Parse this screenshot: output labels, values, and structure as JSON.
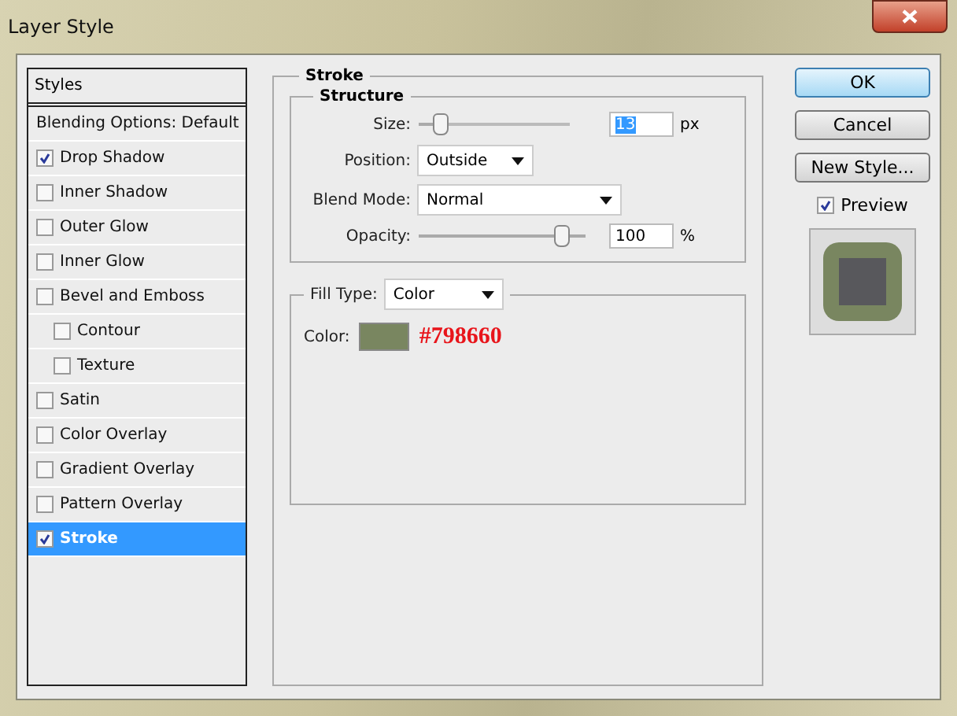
{
  "window": {
    "title": "Layer Style"
  },
  "styles_list": {
    "header": "Styles",
    "blending": "Blending Options: Default",
    "items": [
      {
        "label": "Drop Shadow",
        "checked": true,
        "selected": false,
        "sub": false
      },
      {
        "label": "Inner Shadow",
        "checked": false,
        "selected": false,
        "sub": false
      },
      {
        "label": "Outer Glow",
        "checked": false,
        "selected": false,
        "sub": false
      },
      {
        "label": "Inner Glow",
        "checked": false,
        "selected": false,
        "sub": false
      },
      {
        "label": "Bevel and Emboss",
        "checked": false,
        "selected": false,
        "sub": false
      },
      {
        "label": "Contour",
        "checked": false,
        "selected": false,
        "sub": true
      },
      {
        "label": "Texture",
        "checked": false,
        "selected": false,
        "sub": true
      },
      {
        "label": "Satin",
        "checked": false,
        "selected": false,
        "sub": false
      },
      {
        "label": "Color Overlay",
        "checked": false,
        "selected": false,
        "sub": false
      },
      {
        "label": "Gradient Overlay",
        "checked": false,
        "selected": false,
        "sub": false
      },
      {
        "label": "Pattern Overlay",
        "checked": false,
        "selected": false,
        "sub": false
      },
      {
        "label": "Stroke",
        "checked": true,
        "selected": true,
        "sub": false
      }
    ]
  },
  "stroke": {
    "title": "Stroke",
    "structure": {
      "title": "Structure",
      "rows": [
        {
          "kind": "slider",
          "label": "Size:",
          "level": 0.1,
          "value": "13",
          "unit": "px"
        },
        {
          "kind": "dropdown",
          "label": "Position:",
          "value": "Outside"
        },
        {
          "kind": "dropdown",
          "label": "Blend Mode:",
          "value": "Normal"
        },
        {
          "kind": "slider",
          "label": "Opacity:",
          "level": 1.0,
          "value": "100",
          "unit": "%"
        }
      ]
    },
    "fill": {
      "label": "Fill Type:",
      "value": "Color",
      "color_label": "Color:",
      "color": "#798660",
      "annotation": "#798660"
    }
  },
  "buttons": [
    "OK",
    "Cancel",
    "New Style..."
  ],
  "preview": {
    "label": "Preview",
    "checked": true
  }
}
